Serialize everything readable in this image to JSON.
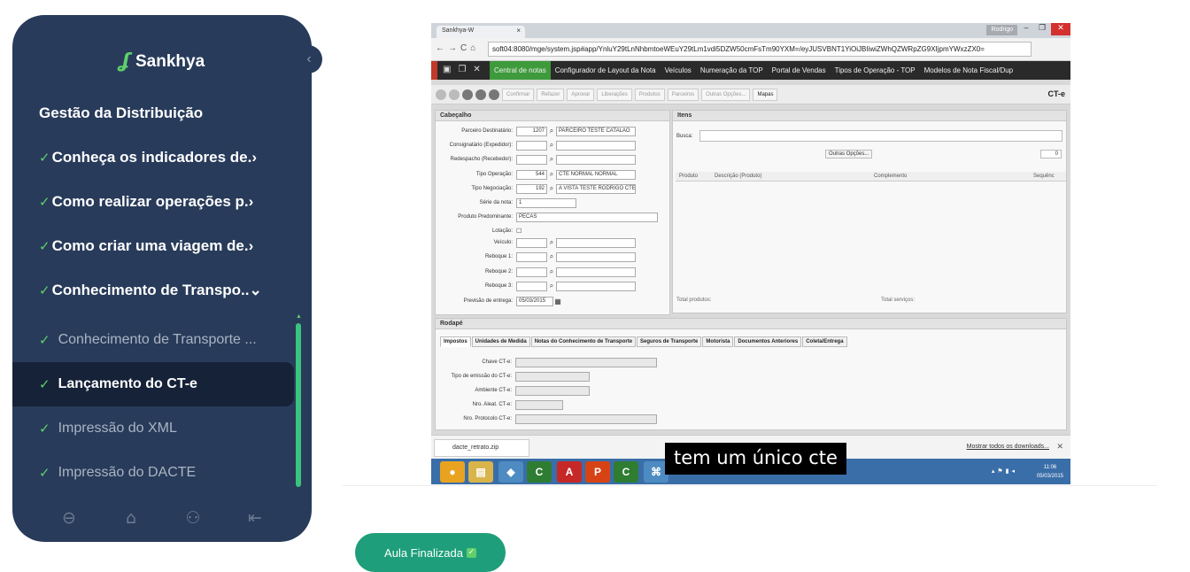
{
  "sidebar": {
    "brand": "Sankhya",
    "collapse_icon": "‹",
    "section_title": "Gestão da Distribuição",
    "modules": [
      {
        "label": "Conheça os indicadores de.›"
      },
      {
        "label": "Como realizar operações p.›"
      },
      {
        "label": "Como criar uma viagem de.›"
      },
      {
        "label": "Conhecimento de Transpo..⌄"
      }
    ],
    "lessons": [
      {
        "label": "Conhecimento de Transporte ..."
      },
      {
        "label": "Lançamento do CT-e"
      },
      {
        "label": "Impressão do XML"
      },
      {
        "label": "Impressão do DACTE"
      }
    ],
    "footer_icons": [
      "arrow-left-icon",
      "home-icon",
      "users-icon",
      "logout-icon"
    ]
  },
  "browser": {
    "tab_title": "Sankhya-W",
    "user": "Rodrigo",
    "url": "soft04:8080/mge/system.jsp#app/YnluY29tLnNhbmtoeWEuY29tLm1vdi5DZW50cmFsTm90YXM=/eyJUSVBNT1YiOiJBIiwiZWhQZWRpZG9XIjpmYWxzZX0="
  },
  "app_menu": {
    "items": [
      "Central de notas",
      "Configurador de Layout da Nota",
      "Veículos",
      "Numeração da TOP",
      "Portal de Vendas",
      "Tipos de Operação - TOP",
      "Modelos de Nota Fiscal/Dup"
    ],
    "active": "Central de notas"
  },
  "toolbar": {
    "buttons": [
      "Confirmar",
      "Refazer",
      "Aprovar",
      "Liberações",
      "Produtos",
      "Parceiros",
      "Outras Opções...",
      "Mapas"
    ],
    "doc_type": "CT-e"
  },
  "cabecalho": {
    "title": "Cabeçalho",
    "fields": [
      {
        "label": "Parceiro Destinatário:",
        "code": "1207",
        "desc": "PARCEIRO TESTE CATALAO"
      },
      {
        "label": "Consignatário (Expedidor):",
        "code": "",
        "desc": ""
      },
      {
        "label": "Redespacho (Recebedor):",
        "code": "",
        "desc": ""
      },
      {
        "label": "Tipo Operação:",
        "code": "544",
        "desc": "CTE NORMAL NORMAL"
      },
      {
        "label": "Tipo Negociação:",
        "code": "192",
        "desc": "A VISTA TESTE RODRIGO CTE"
      },
      {
        "label": "Série da nota:",
        "code": "1",
        "desc": ""
      },
      {
        "label": "Produto Predominante:",
        "code": "PECAS",
        "desc": ""
      },
      {
        "label": "Lotação:",
        "code": "",
        "desc": ""
      },
      {
        "label": "Veículo:",
        "code": "",
        "desc": ""
      },
      {
        "label": "Reboque 1:",
        "code": "",
        "desc": ""
      },
      {
        "label": "Reboque 2:",
        "code": "",
        "desc": ""
      },
      {
        "label": "Reboque 3:",
        "code": "",
        "desc": ""
      },
      {
        "label": "Previsão de entrega:",
        "code": "05/03/2015",
        "desc": ""
      }
    ]
  },
  "itens": {
    "title": "Itens",
    "search_label": "Busca:",
    "other_options": "Outras Opções...",
    "count": "0",
    "columns": [
      "Produto",
      "Descrição (Produto)",
      "Complemento",
      "Sequênc"
    ],
    "total_products": "Total produtos:",
    "total_services": "Total serviços:"
  },
  "rodape": {
    "title": "Rodapé",
    "tabs": [
      "Impostos",
      "Unidades de Medida",
      "Notas do Conhecimento de Transporte",
      "Seguros de Transporte",
      "Motorista",
      "Documentos Anteriores",
      "Coleta/Entrega"
    ],
    "fields": [
      "Chave CT-e:",
      "Tipo de emissão do CT-e:",
      "Ambiente CT-e:",
      "Nro. Aleat. CT-e:",
      "Nro. Protocolo CT-e:"
    ]
  },
  "downloads": {
    "file": "dacte_retrato.zip",
    "show_all": "Mostrar todos os downloads..."
  },
  "taskbar": {
    "time": "11:06",
    "date": "05/03/2015"
  },
  "caption": "tem um único cte",
  "finish_button": {
    "label": "Aula Finalizada",
    "icon": "check-icon"
  },
  "colors": {
    "sidebar_bg": "#283b5a",
    "active_lesson_bg": "#162238",
    "accent_green": "#5fd06a",
    "finish_button_bg": "#1e9e7a"
  }
}
